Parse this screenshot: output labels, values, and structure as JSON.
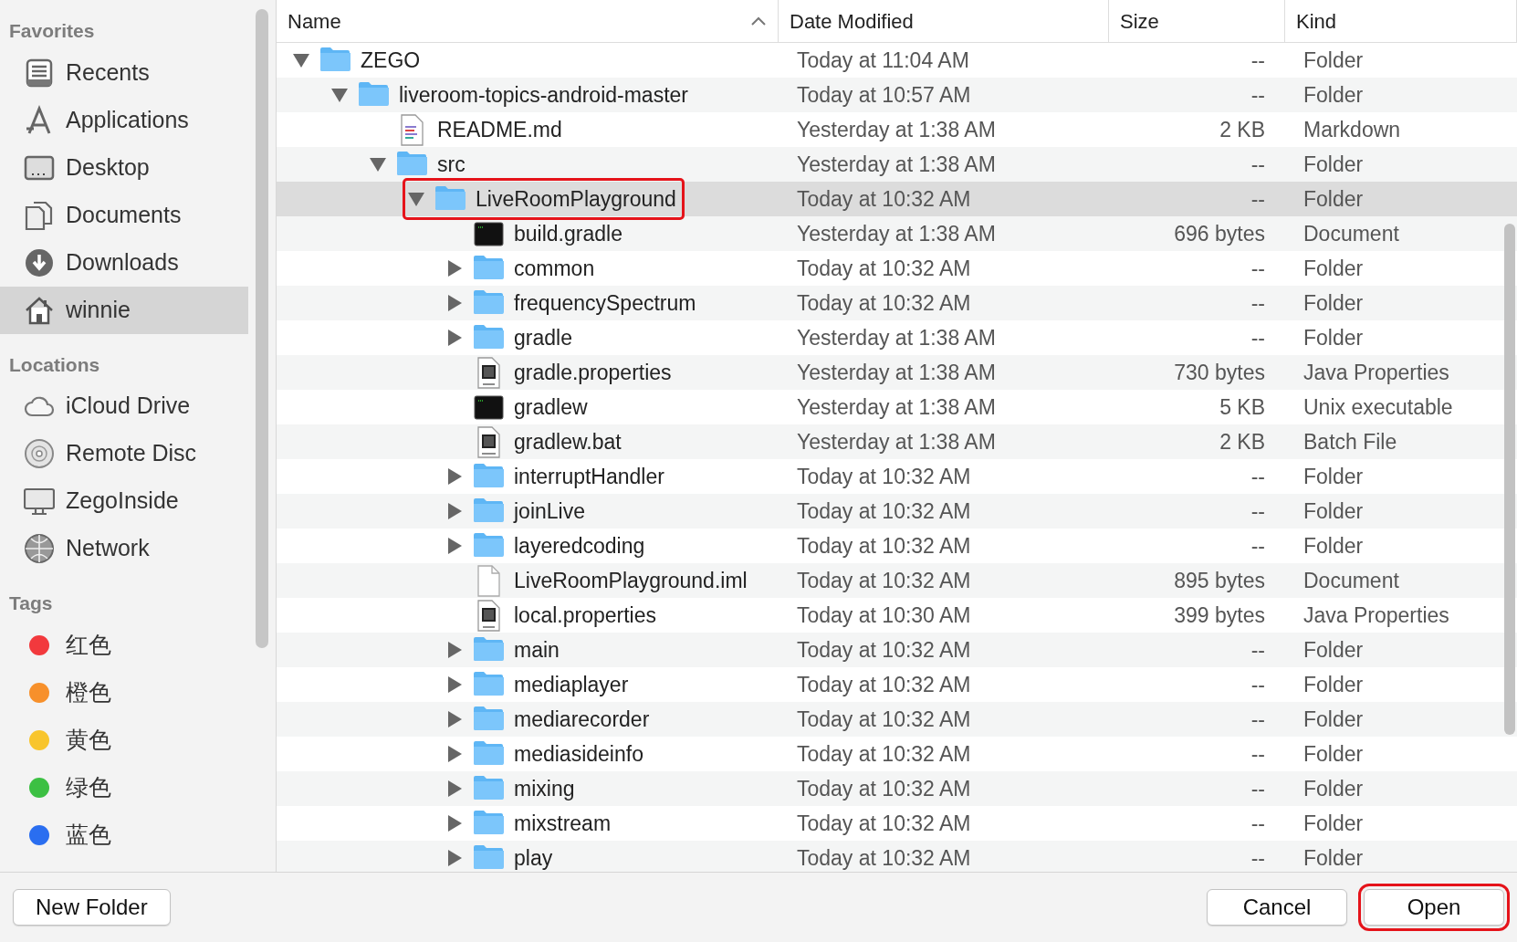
{
  "sidebar": [
    {
      "heading": "Favorites",
      "items": [
        {
          "label": "Recents",
          "kind": "recents",
          "selected": false
        },
        {
          "label": "Applications",
          "kind": "apps",
          "selected": false
        },
        {
          "label": "Desktop",
          "kind": "desktop",
          "selected": false
        },
        {
          "label": "Documents",
          "kind": "documents",
          "selected": false
        },
        {
          "label": "Downloads",
          "kind": "downloads",
          "selected": false
        },
        {
          "label": "winnie",
          "kind": "home",
          "selected": true
        }
      ]
    },
    {
      "heading": "Locations",
      "items": [
        {
          "label": "iCloud Drive",
          "kind": "cloud",
          "selected": false
        },
        {
          "label": "Remote Disc",
          "kind": "disc",
          "selected": false
        },
        {
          "label": "ZegoInside",
          "kind": "monitor",
          "selected": false
        },
        {
          "label": "Network",
          "kind": "globe",
          "selected": false
        }
      ]
    },
    {
      "heading": "Tags",
      "items": [
        {
          "label": "红色",
          "kind": "tag",
          "color": "#f2393d",
          "selected": false
        },
        {
          "label": "橙色",
          "kind": "tag",
          "color": "#f7902b",
          "selected": false
        },
        {
          "label": "黄色",
          "kind": "tag",
          "color": "#f8c52c",
          "selected": false
        },
        {
          "label": "绿色",
          "kind": "tag",
          "color": "#3cc043",
          "selected": false
        },
        {
          "label": "蓝色",
          "kind": "tag",
          "color": "#2a6ef0",
          "selected": false
        }
      ]
    }
  ],
  "columns": [
    {
      "label": "Name",
      "sorted": true
    },
    {
      "label": "Date Modified",
      "sorted": false
    },
    {
      "label": "Size",
      "sorted": false
    },
    {
      "label": "Kind",
      "sorted": false
    }
  ],
  "files": [
    {
      "name": "ZEGO",
      "kind": "folder",
      "expanded": true,
      "selected": false,
      "annotated": false,
      "date": "Today at 11:04 AM",
      "size": "--",
      "kind_column": "Folder",
      "children": [
        {
          "name": "liveroom-topics-android-master",
          "kind": "folder",
          "expanded": true,
          "selected": false,
          "annotated": false,
          "date": "Today at 10:57 AM",
          "size": "--",
          "kind_column": "Folder",
          "children": [
            {
              "name": "README.md",
              "kind": "markdown",
              "selected": false,
              "annotated": false,
              "date": "Yesterday at 1:38 AM",
              "size": "2 KB",
              "kind_column": "Markdown"
            },
            {
              "name": "src",
              "kind": "folder",
              "expanded": true,
              "selected": false,
              "annotated": false,
              "date": "Yesterday at 1:38 AM",
              "size": "--",
              "kind_column": "Folder",
              "children": [
                {
                  "name": "LiveRoomPlayground",
                  "kind": "folder",
                  "expanded": true,
                  "selected": true,
                  "annotated": true,
                  "date": "Today at 10:32 AM",
                  "size": "--",
                  "kind_column": "Folder",
                  "children": [
                    {
                      "name": "build.gradle",
                      "kind": "terminal",
                      "selected": false,
                      "annotated": false,
                      "date": "Yesterday at 1:38 AM",
                      "size": "696 bytes",
                      "kind_column": "Document"
                    },
                    {
                      "name": "common",
                      "kind": "folder",
                      "expanded": false,
                      "selected": false,
                      "annotated": false,
                      "date": "Today at 10:32 AM",
                      "size": "--",
                      "kind_column": "Folder"
                    },
                    {
                      "name": "frequencySpectrum",
                      "kind": "folder",
                      "expanded": false,
                      "selected": false,
                      "annotated": false,
                      "date": "Today at 10:32 AM",
                      "size": "--",
                      "kind_column": "Folder"
                    },
                    {
                      "name": "gradle",
                      "kind": "folder",
                      "expanded": false,
                      "selected": false,
                      "annotated": false,
                      "date": "Yesterday at 1:38 AM",
                      "size": "--",
                      "kind_column": "Folder"
                    },
                    {
                      "name": "gradle.properties",
                      "kind": "java",
                      "selected": false,
                      "annotated": false,
                      "date": "Yesterday at 1:38 AM",
                      "size": "730 bytes",
                      "kind_column": "Java Properties"
                    },
                    {
                      "name": "gradlew",
                      "kind": "terminal",
                      "selected": false,
                      "annotated": false,
                      "date": "Yesterday at 1:38 AM",
                      "size": "5 KB",
                      "kind_column": "Unix executable"
                    },
                    {
                      "name": "gradlew.bat",
                      "kind": "batch",
                      "selected": false,
                      "annotated": false,
                      "date": "Yesterday at 1:38 AM",
                      "size": "2 KB",
                      "kind_column": "Batch File"
                    },
                    {
                      "name": "interruptHandler",
                      "kind": "folder",
                      "expanded": false,
                      "selected": false,
                      "annotated": false,
                      "date": "Today at 10:32 AM",
                      "size": "--",
                      "kind_column": "Folder"
                    },
                    {
                      "name": "joinLive",
                      "kind": "folder",
                      "expanded": false,
                      "selected": false,
                      "annotated": false,
                      "date": "Today at 10:32 AM",
                      "size": "--",
                      "kind_column": "Folder"
                    },
                    {
                      "name": "layeredcoding",
                      "kind": "folder",
                      "expanded": false,
                      "selected": false,
                      "annotated": false,
                      "date": "Today at 10:32 AM",
                      "size": "--",
                      "kind_column": "Folder"
                    },
                    {
                      "name": "LiveRoomPlayground.iml",
                      "kind": "plain",
                      "selected": false,
                      "annotated": false,
                      "date": "Today at 10:32 AM",
                      "size": "895 bytes",
                      "kind_column": "Document"
                    },
                    {
                      "name": "local.properties",
                      "kind": "java",
                      "selected": false,
                      "annotated": false,
                      "date": "Today at 10:30 AM",
                      "size": "399 bytes",
                      "kind_column": "Java Properties"
                    },
                    {
                      "name": "main",
                      "kind": "folder",
                      "expanded": false,
                      "selected": false,
                      "annotated": false,
                      "date": "Today at 10:32 AM",
                      "size": "--",
                      "kind_column": "Folder"
                    },
                    {
                      "name": "mediaplayer",
                      "kind": "folder",
                      "expanded": false,
                      "selected": false,
                      "annotated": false,
                      "date": "Today at 10:32 AM",
                      "size": "--",
                      "kind_column": "Folder"
                    },
                    {
                      "name": "mediarecorder",
                      "kind": "folder",
                      "expanded": false,
                      "selected": false,
                      "annotated": false,
                      "date": "Today at 10:32 AM",
                      "size": "--",
                      "kind_column": "Folder"
                    },
                    {
                      "name": "mediasideinfo",
                      "kind": "folder",
                      "expanded": false,
                      "selected": false,
                      "annotated": false,
                      "date": "Today at 10:32 AM",
                      "size": "--",
                      "kind_column": "Folder"
                    },
                    {
                      "name": "mixing",
                      "kind": "folder",
                      "expanded": false,
                      "selected": false,
                      "annotated": false,
                      "date": "Today at 10:32 AM",
                      "size": "--",
                      "kind_column": "Folder"
                    },
                    {
                      "name": "mixstream",
                      "kind": "folder",
                      "expanded": false,
                      "selected": false,
                      "annotated": false,
                      "date": "Today at 10:32 AM",
                      "size": "--",
                      "kind_column": "Folder"
                    },
                    {
                      "name": "play",
                      "kind": "folder",
                      "expanded": false,
                      "selected": false,
                      "annotated": false,
                      "date": "Today at 10:32 AM",
                      "size": "--",
                      "kind_column": "Folder"
                    }
                  ]
                }
              ]
            }
          ]
        }
      ]
    }
  ],
  "buttons": [
    {
      "label": "New Folder",
      "annotated": false
    },
    {
      "label": "Cancel",
      "annotated": false
    },
    {
      "label": "Open",
      "annotated": true
    }
  ]
}
